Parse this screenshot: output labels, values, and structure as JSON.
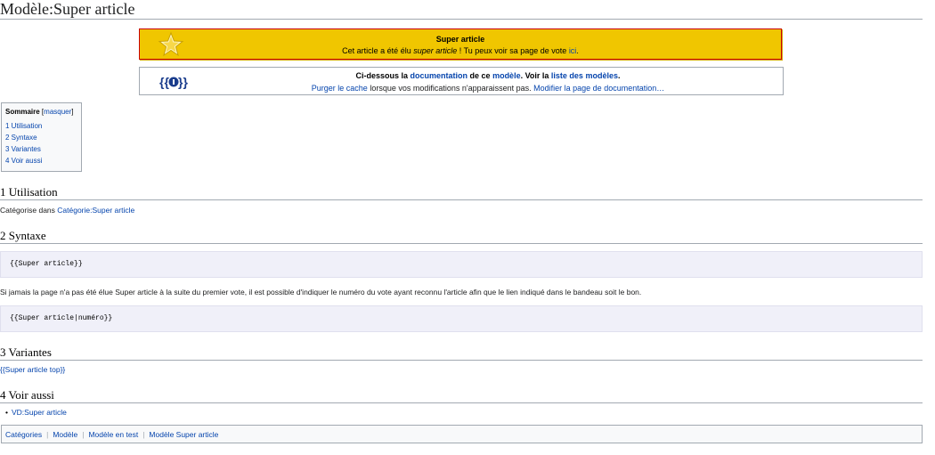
{
  "page": {
    "title": "Modèle:Super article"
  },
  "banner": {
    "title": "Super article",
    "text_before": "Cet article a été élu ",
    "text_italic": "super article",
    "text_after": " ! Tu peux voir sa page de vote ",
    "link": "ici",
    "text_end": "."
  },
  "doc": {
    "line1": [
      "Ci-dessous la ",
      "documentation",
      " de ce ",
      "modèle",
      ". Voir la ",
      "liste des modèles",
      "."
    ],
    "purge": "Purger le cache",
    "line2_mid": " lorsque vos modifications n'apparaissent pas. ",
    "edit_doc": "Modifier la page de documentation",
    "line2_end": "…"
  },
  "toc": {
    "title": "Sommaire",
    "toggle_open": "[",
    "toggle": "masquer",
    "toggle_close": "]",
    "items": [
      "1 Utilisation",
      "2 Syntaxe",
      "3 Variantes",
      "4 Voir aussi"
    ]
  },
  "sections": {
    "utilisation": {
      "heading": "1 Utilisation",
      "text": "Catégorise dans ",
      "link": "Catégorie:Super article"
    },
    "syntaxe": {
      "heading": "2 Syntaxe",
      "code1": "{{Super article}}",
      "text": "Si jamais la page n'a pas été élue Super article à la suite du premier vote, il est possible d'indiquer le numéro du vote ayant reconnu l'article afin que le lien indiqué dans le bandeau soit le bon.",
      "code2": "{{Super article|numéro}}"
    },
    "variantes": {
      "heading": "3 Variantes",
      "link": "{{Super article top}}"
    },
    "voir": {
      "heading": "4 Voir aussi",
      "items": [
        "VD:Super article"
      ]
    }
  },
  "categories": {
    "label": "Catégories",
    "colon": ":",
    "items": [
      "Modèle",
      "Modèle en test",
      "Modèle Super article"
    ]
  },
  "colors": {
    "banner_bg": "#f0c600",
    "banner_border": "#c80000",
    "link": "#0645ad",
    "code_bg": "#f0f0f9"
  }
}
